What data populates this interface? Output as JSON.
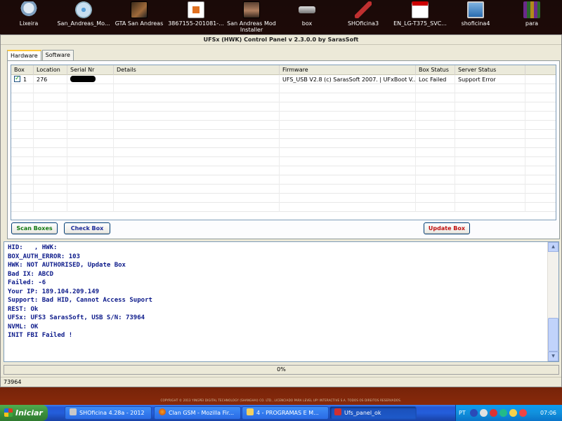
{
  "desktop": {
    "icons": [
      {
        "label": "Lixeira",
        "icon": "recycle-bin-icon"
      },
      {
        "label": "San_Andreas_Mo...",
        "icon": "disc-icon"
      },
      {
        "label": "GTA San Andreas",
        "icon": "game-icon"
      },
      {
        "label": "3867155-201081-...",
        "icon": "document-icon"
      },
      {
        "label": "San Andreas Mod Installer",
        "icon": "portrait-icon"
      },
      {
        "label": "box",
        "icon": "drive-icon"
      },
      {
        "label": "SHOficina3",
        "icon": "wrench-icon"
      },
      {
        "label": "EN_LG-T375_SVC...",
        "icon": "pdf-icon"
      },
      {
        "label": "shoficina4",
        "icon": "monitor-icon"
      },
      {
        "label": "para",
        "icon": "archive-icon"
      }
    ],
    "copyright": "COPYRIGHT © 2013 YINGPEI DIGITAL TECHNOLOGY (SHANGHAI) CO. LTD., LICENCIADO PARA LEVEL UP! INTERACTIVE S.A. TODOS OS DIREITOS RESERVADOS."
  },
  "window": {
    "title": "UFSx (HWK) Control Panel v 2.3.0.0 by SarasSoft",
    "tabs": [
      "Hardware",
      "Software"
    ],
    "grid": {
      "columns": [
        "Box",
        "Location",
        "Serial Nr",
        "Details",
        "Firmware",
        "Box Status",
        "Server Status"
      ],
      "rows": [
        {
          "box": "1",
          "checked": true,
          "location": "276",
          "serial": "",
          "details": "",
          "firmware": "UFS_USB V2.8 (c) SarasSoft 2007. | UFxBoot V...",
          "box_status": "Loc Failed",
          "server_status": "Support Error"
        }
      ]
    },
    "buttons": {
      "scan": "Scan Boxes",
      "check": "Check Box",
      "update": "Update Box"
    },
    "log_lines": [
      "HID:   , HWK:",
      "BOX_AUTH_ERROR: 103",
      "HWK: NOT AUTHORISED, Update Box",
      "Bad IX: ABCD",
      "Failed: -6",
      "Your IP: 189.104.209.149",
      "Support: Bad HID, Cannot Access Suport",
      "REST: Ok",
      "UFSx: UFS3 SarasSoft, USB S/N: 73964",
      "NVML: OK",
      "INIT FBI Failed !"
    ],
    "progress": "0%",
    "status": "73964"
  },
  "taskbar": {
    "start": "Iniciar",
    "tasks": [
      {
        "label": "SHOficina 4.28a - 2012",
        "active": false
      },
      {
        "label": "Clan GSM - Mozilla Fir...",
        "active": false
      },
      {
        "label": "4 - PROGRAMAS E M...",
        "active": false
      },
      {
        "label": "Ufs_panel_ok",
        "active": true
      }
    ],
    "tray": {
      "lang": "PT",
      "clock": "07:06"
    }
  }
}
